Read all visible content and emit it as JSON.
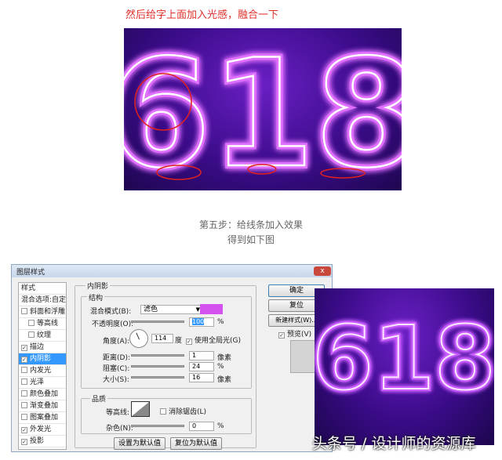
{
  "caption_top": "然后给字上面加入光感，融合一下",
  "artwork_text": "618",
  "caption_step": "第五步：给线条加入效果",
  "caption_result": "得到如下图",
  "dialog": {
    "title": "图层样式",
    "close": "x",
    "styles_header": "样式",
    "blend_options": "混合选项:自定",
    "styles": [
      {
        "label": "斜面和浮雕",
        "checked": false
      },
      {
        "label": "等高线",
        "checked": false
      },
      {
        "label": "纹理",
        "checked": false
      },
      {
        "label": "描边",
        "checked": true
      },
      {
        "label": "内阴影",
        "checked": true
      },
      {
        "label": "内发光",
        "checked": false
      },
      {
        "label": "光泽",
        "checked": false
      },
      {
        "label": "颜色叠加",
        "checked": false
      },
      {
        "label": "渐变叠加",
        "checked": false
      },
      {
        "label": "图案叠加",
        "checked": false
      },
      {
        "label": "外发光",
        "checked": true
      },
      {
        "label": "投影",
        "checked": true
      }
    ],
    "section": "内阴影",
    "structure": "结构",
    "blend_mode_label": "混合模式(B):",
    "blend_mode": "滤色",
    "color": "#d452f0",
    "opacity_label": "不透明度(O):",
    "opacity": "100",
    "pct": "%",
    "angle_label": "角度(A):",
    "angle": "114",
    "degree": "度",
    "global_light": "使用全局光(G)",
    "distance_label": "距离(D):",
    "distance": "1",
    "px": "像素",
    "choke_label": "阻塞(C):",
    "choke": "24",
    "size_label": "大小(S):",
    "size": "16",
    "quality": "品质",
    "contour_label": "等高线:",
    "antialias": "消除锯齿(L)",
    "noise_label": "杂色(N):",
    "noise": "0",
    "set_default": "设置为默认值",
    "reset_default": "复位为默认值",
    "ok": "确定",
    "reset": "复位",
    "new_style": "新建样式(W)...",
    "preview": "预览(V)"
  },
  "watermark": "头条号 / 设计师的资源库"
}
